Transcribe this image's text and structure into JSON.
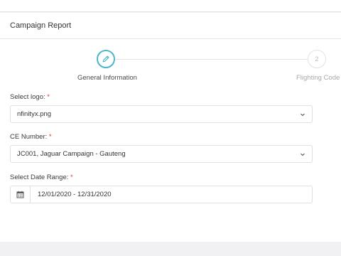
{
  "header": {
    "title": "Campaign Report"
  },
  "stepper": {
    "steps": [
      {
        "label": "General Information",
        "number": ""
      },
      {
        "label": "Flighting Code",
        "number": "2"
      }
    ]
  },
  "form": {
    "logo": {
      "label": "Select logo:",
      "required": "*",
      "value": "nfinityx.png"
    },
    "ce": {
      "label": "CE Number:",
      "required": "*",
      "value": "JC001, Jaguar Campaign - Gauteng"
    },
    "date": {
      "label": "Select Date Range:",
      "required": "*",
      "value": "12/01/2020 - 12/31/2020"
    }
  },
  "colors": {
    "accent": "#4db6c9",
    "required": "#e3342f"
  },
  "icons": {
    "step1": "pencil-icon",
    "dropdown": "chevron-down-icon",
    "calendar": "calendar-icon"
  }
}
